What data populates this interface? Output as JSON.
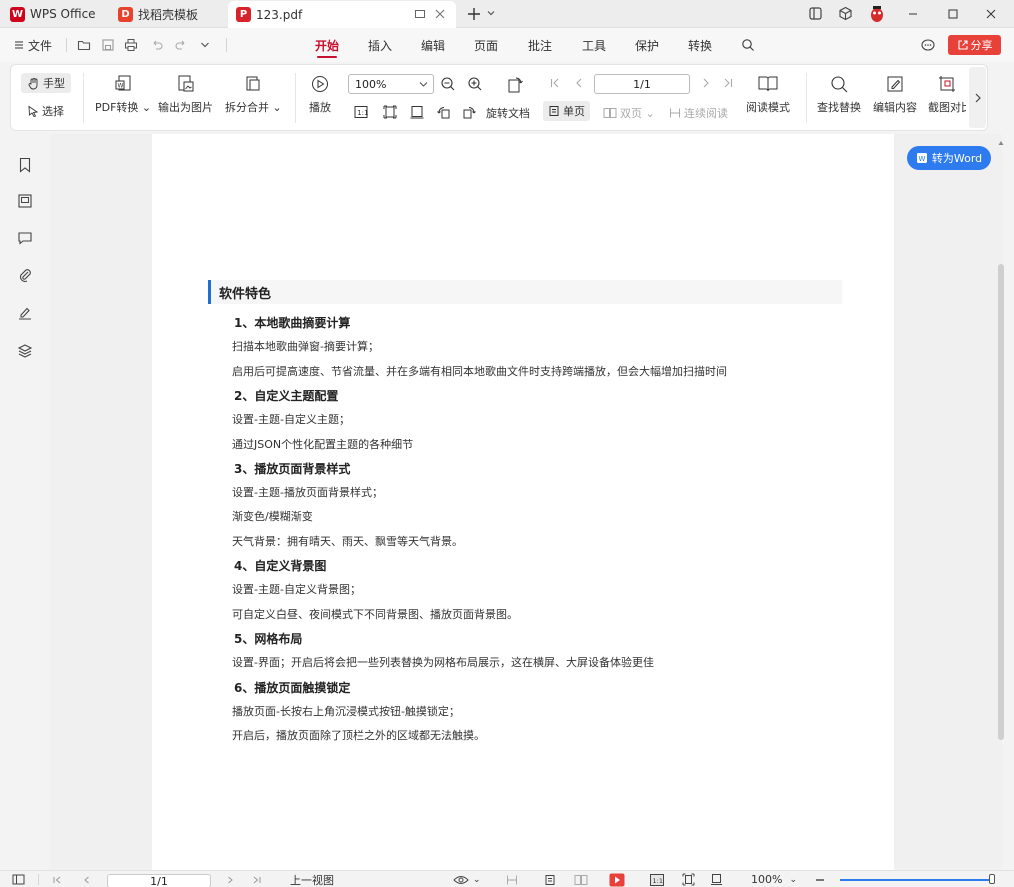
{
  "titlebar": {
    "tabs": [
      {
        "label": "WPS Office"
      },
      {
        "label": "找稻壳模板"
      },
      {
        "label": "123.pdf"
      }
    ]
  },
  "menubar": {
    "file_label": "文件",
    "items": [
      "开始",
      "插入",
      "编辑",
      "页面",
      "批注",
      "工具",
      "保护",
      "转换"
    ],
    "share_label": "分享"
  },
  "ribbon": {
    "hand_tool": "手型",
    "select_tool": "选择",
    "pdf_convert": "PDF转换",
    "export_image": "输出为图片",
    "split_merge": "拆分合并",
    "play": "播放",
    "zoom_value": "100%",
    "rotate_doc": "旋转文档",
    "single_page": "单页",
    "double_page": "双页",
    "continuous": "连续阅读",
    "page_value": "1/1",
    "read_mode": "阅读模式",
    "find_replace": "查找替换",
    "edit_content": "编辑内容",
    "screenshot_compare": "截图对比"
  },
  "document": {
    "convert_word": "转为Word",
    "section_title": "软件特色",
    "blocks": [
      {
        "type": "h",
        "text": "1、本地歌曲摘要计算"
      },
      {
        "type": "p",
        "text": "扫描本地歌曲弹窗-摘要计算；"
      },
      {
        "type": "p",
        "text": "启用后可提高速度、节省流量、并在多端有相同本地歌曲文件时支持跨端播放，但会大幅增加扫描时间"
      },
      {
        "type": "h",
        "text": "2、自定义主题配置"
      },
      {
        "type": "p",
        "text": "设置-主题-自定义主题；"
      },
      {
        "type": "p",
        "text": "通过JSON个性化配置主题的各种细节"
      },
      {
        "type": "h",
        "text": "3、播放页面背景样式"
      },
      {
        "type": "p",
        "text": "设置-主题-播放页面背景样式；"
      },
      {
        "type": "p",
        "text": "渐变色/模糊渐变"
      },
      {
        "type": "p",
        "text": "天气背景：拥有晴天、雨天、飘雪等天气背景。"
      },
      {
        "type": "h",
        "text": "4、自定义背景图"
      },
      {
        "type": "p",
        "text": "设置-主题-自定义背景图；"
      },
      {
        "type": "p",
        "text": "可自定义白昼、夜间模式下不同背景图、播放页面背景图。"
      },
      {
        "type": "h",
        "text": "5、网格布局"
      },
      {
        "type": "p",
        "text": "设置-界面；开启后将会把一些列表替换为网格布局展示，这在横屏、大屏设备体验更佳"
      },
      {
        "type": "h",
        "text": "6、播放页面触摸锁定"
      },
      {
        "type": "p",
        "text": "播放页面-长按右上角沉浸模式按钮-触摸锁定；"
      },
      {
        "type": "p",
        "text": "开启后，播放页面除了顶栏之外的区域都无法触摸。"
      }
    ]
  },
  "statusbar": {
    "page_value": "1/1",
    "prev_view": "上一视图",
    "zoom_value": "100%"
  },
  "colors": {
    "accent_red": "#c8102e",
    "accent_blue": "#2e7bf0"
  }
}
